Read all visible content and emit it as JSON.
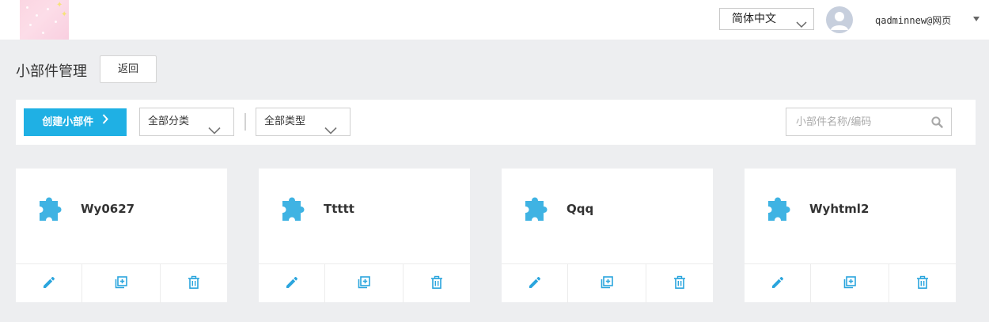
{
  "header": {
    "language": {
      "selected": "简体中文",
      "icon": "chevron-down-icon"
    },
    "user": {
      "name": "qadminnew@网页",
      "avatar_icon": "user-avatar-icon",
      "menu_icon": "caret-down-icon"
    }
  },
  "page": {
    "title": "小部件管理",
    "back_label": "返回"
  },
  "toolbar": {
    "create_label": "创建小部件",
    "category_filter": "全部分类",
    "type_filter": "全部类型",
    "search_placeholder": "小部件名称/编码",
    "search_icon": "search-icon"
  },
  "colors": {
    "accent": "#1fb0e4",
    "icon_blue": "#3fb3e3",
    "background": "#edeef0"
  },
  "widgets": [
    {
      "name": "Wy0627",
      "icon": "puzzle-piece-icon"
    },
    {
      "name": "Ttttt",
      "icon": "puzzle-piece-icon"
    },
    {
      "name": "Qqq",
      "icon": "puzzle-piece-icon"
    },
    {
      "name": "Wyhtml2",
      "icon": "puzzle-piece-icon"
    }
  ],
  "card_actions": [
    "edit-icon",
    "copy-icon",
    "delete-icon"
  ]
}
